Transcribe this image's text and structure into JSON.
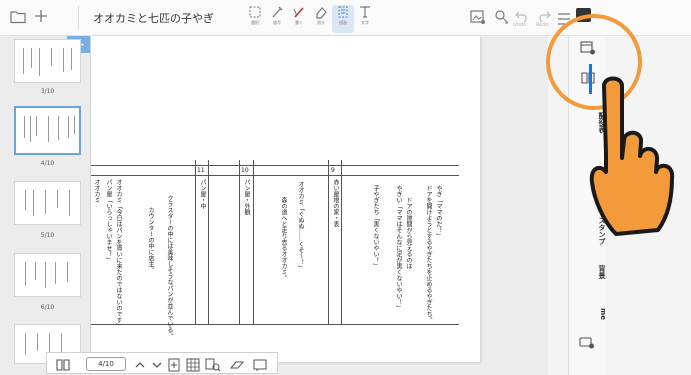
{
  "header": {
    "title": "オオカミと七匹の子やぎ",
    "tools": [
      {
        "label": "選択"
      },
      {
        "label": "描写"
      },
      {
        "label": "書く"
      },
      {
        "label": "消す"
      },
      {
        "label": "描画"
      },
      {
        "label": "文字"
      }
    ],
    "undo_label": "Undo",
    "redo_label": "Redo"
  },
  "thumbnails": [
    {
      "label": "3/10",
      "selected": false
    },
    {
      "label": "4/10",
      "selected": true
    },
    {
      "label": "5/10",
      "selected": false
    },
    {
      "label": "6/10",
      "selected": false
    }
  ],
  "script": {
    "scene_numbers": [
      "11",
      "10",
      "9"
    ],
    "columns": [
      "やぎ「ママのだ！」",
      "ドアを開けようとするやぎたちを止めるやぎたち。",
      "ドアの隙間から見えるのは",
      "やぎい「ママはそんなに足が黒くないやい！」",
      "子やぎたち「黒くないやい！」",
      "赤い屋根の家・表",
      "オオカミ「ぐぬぬ……くそ〜！」",
      "森の道へと走り去るオオカミ。",
      "パン屋・外観",
      "パン屋・中",
      "クラスターの中には美味しそうなパンが並んでいる。",
      "カウンターの中に店主。",
      "オオカミ「今日はパンを貰いに来たのではないのです」",
      "パン屋「いらっしゃいませ！」",
      "オオカミ"
    ]
  },
  "bottombar": {
    "page_indicator": "4/10"
  },
  "right_panel": {
    "tabs": [
      "配役表",
      "ト書",
      "スタンプ",
      "背景",
      "me"
    ]
  },
  "colors": {
    "accent": "#1e6fe8",
    "thumb_select": "#6ba4dd",
    "highlight": "#f39a3b"
  }
}
